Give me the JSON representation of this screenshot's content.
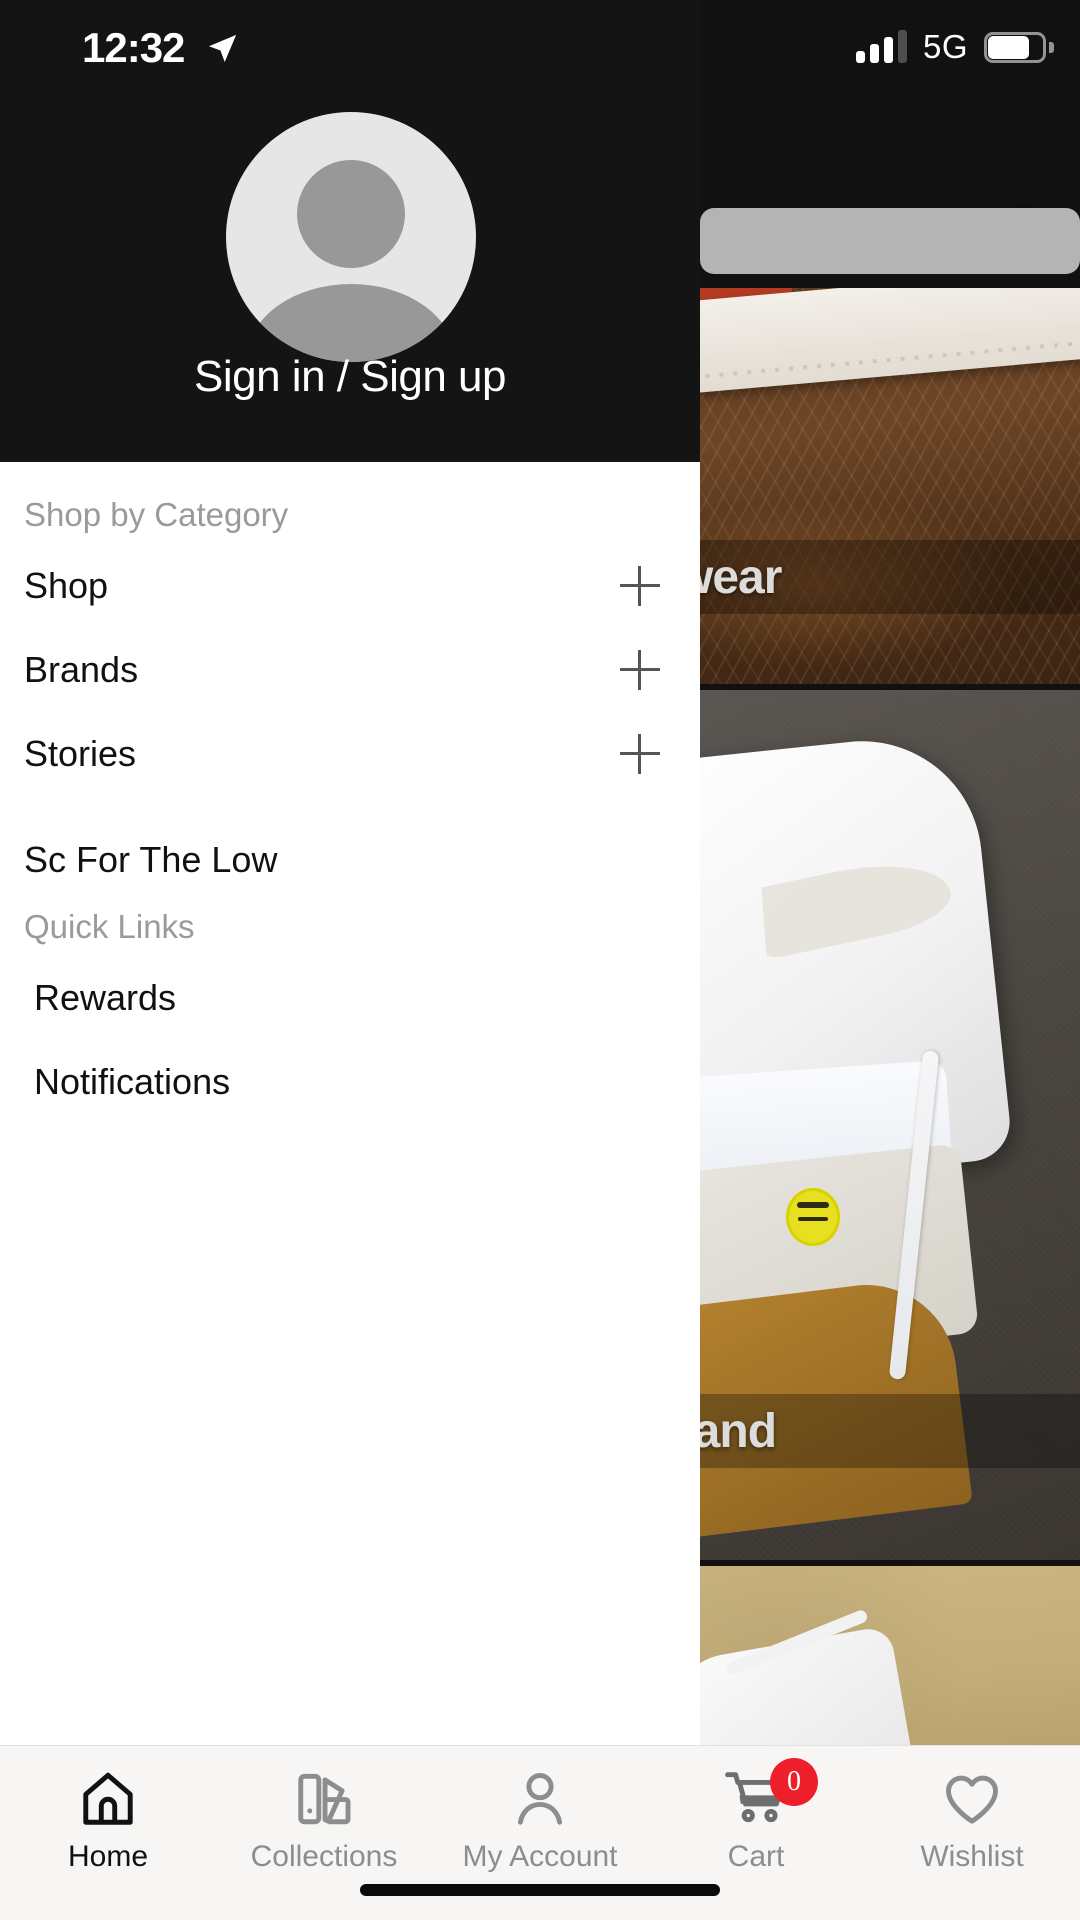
{
  "status_bar": {
    "time": "12:32",
    "location_icon": "location-arrow-icon",
    "signal_icon": "cellular-signal-icon",
    "signal_bars_filled": 3,
    "signal_bars_total": 4,
    "network": "5G",
    "battery_icon": "battery-icon",
    "battery_percent": 66
  },
  "background": {
    "cart_icon": "shopping-cart-icon",
    "cart_count": "0",
    "search_placeholder": "",
    "cards": [
      {
        "caption": "wear",
        "alt": "brown-leather-sneaker-card"
      },
      {
        "caption": "rand",
        "alt": "white-high-top-sneaker-card"
      },
      {
        "caption": "",
        "alt": "tan-floor-sneaker-card"
      }
    ]
  },
  "drawer": {
    "avatar_icon": "user-avatar-icon",
    "sign_in_label": "Sign in / Sign up",
    "sections": [
      {
        "label": "Shop by Category",
        "items": [
          {
            "label": "Shop",
            "expand_icon": "plus-icon",
            "expandable": true
          },
          {
            "label": "Brands",
            "expand_icon": "plus-icon",
            "expandable": true
          },
          {
            "label": "Stories",
            "expand_icon": "plus-icon",
            "expandable": true
          }
        ]
      },
      {
        "label": "",
        "items": [
          {
            "label": "Sc For The Low",
            "expandable": false
          }
        ]
      },
      {
        "label": "Quick Links",
        "items": [
          {
            "label": "Rewards",
            "expandable": false
          },
          {
            "label": "Notifications",
            "expandable": false
          }
        ]
      }
    ]
  },
  "bottom_nav": {
    "items": [
      {
        "label": "Home",
        "icon": "home-icon",
        "active": true,
        "badge": ""
      },
      {
        "label": "Collections",
        "icon": "collections-icon",
        "active": false,
        "badge": ""
      },
      {
        "label": "My Account",
        "icon": "person-icon",
        "active": false,
        "badge": ""
      },
      {
        "label": "Cart",
        "icon": "shopping-cart-icon",
        "active": false,
        "badge": "0"
      },
      {
        "label": "Wishlist",
        "icon": "heart-icon",
        "active": false,
        "badge": ""
      }
    ]
  },
  "colors": {
    "drawer_header_bg": "#141414",
    "drawer_bg": "#ffffff",
    "accent_badge": "#ee1f2a",
    "muted_text": "#9a9a9a",
    "primary_text": "#111111",
    "bottom_nav_bg": "#f7f6f4"
  }
}
